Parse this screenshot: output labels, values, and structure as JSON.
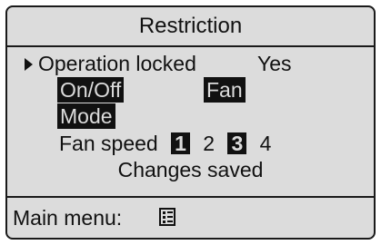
{
  "screen": {
    "title": "Restriction",
    "operation_locked_label": "Operation locked",
    "operation_locked_value": "Yes",
    "options": {
      "onoff": "On/Off",
      "fan": "Fan",
      "mode": "Mode"
    },
    "fan_speed": {
      "label": "Fan speed",
      "levels": [
        "1",
        "2",
        "3",
        "4"
      ],
      "locked_levels": [
        "1",
        "3"
      ]
    },
    "status": "Changes saved"
  },
  "footer": {
    "main_menu_label": "Main menu:",
    "main_menu_icon": "menu-list-icon"
  }
}
